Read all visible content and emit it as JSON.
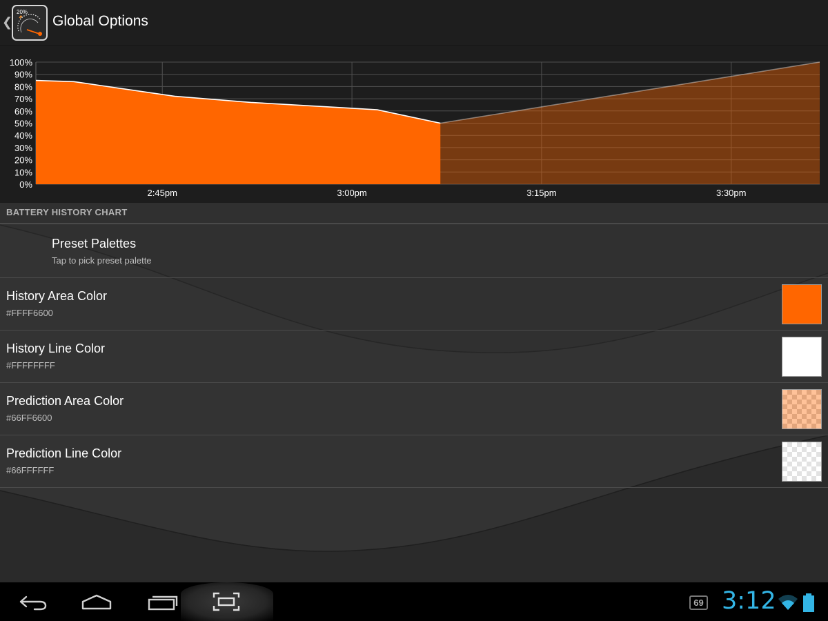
{
  "header": {
    "title": "Global Options",
    "app_icon": {
      "label": "20%",
      "icon": "battery-gauge-icon"
    },
    "back_icon": "chevron-left-icon"
  },
  "chart_data": {
    "type": "area",
    "title": "",
    "xlabel": "",
    "ylabel": "",
    "ylim": [
      0,
      100
    ],
    "yticks": [
      "0%",
      "10%",
      "20%",
      "30%",
      "40%",
      "50%",
      "60%",
      "70%",
      "80%",
      "90%",
      "100%"
    ],
    "xlim": [
      "2:35pm",
      "3:37pm"
    ],
    "xticks": [
      "2:45pm",
      "3:00pm",
      "3:15pm",
      "3:30pm"
    ],
    "grid": true,
    "series": [
      {
        "kind": "history",
        "area_color": "#FF6600",
        "line_color": "#FFFFFF",
        "x": [
          "2:35pm",
          "2:38pm",
          "2:40pm",
          "2:46pm",
          "2:52pm",
          "3:02pm",
          "3:07pm"
        ],
        "values": [
          85,
          84,
          81,
          72,
          67,
          61,
          50
        ]
      },
      {
        "kind": "prediction",
        "area_color": "#66FF6600",
        "line_color": "#66FFFFFF",
        "x": [
          "3:07pm",
          "3:37pm"
        ],
        "values": [
          50,
          100
        ]
      }
    ]
  },
  "section": {
    "header": "BATTERY HISTORY CHART"
  },
  "preferences": [
    {
      "title": "Preset Palettes",
      "summary": "Tap to pick preset palette",
      "swatch": null
    },
    {
      "title": "History Area Color",
      "summary": "#FFFF6600",
      "swatch": "#FF6600",
      "swatch_alpha": 1
    },
    {
      "title": "History Line Color",
      "summary": "#FFFFFFFF",
      "swatch": "#FFFFFF",
      "swatch_alpha": 1
    },
    {
      "title": "Prediction Area Color",
      "summary": "#66FF6600",
      "swatch": "#FF6600",
      "swatch_alpha": 0.4
    },
    {
      "title": "Prediction Line Color",
      "summary": "#66FFFFFF",
      "swatch": "#FFFFFF",
      "swatch_alpha": 0.4
    }
  ],
  "navbar": {
    "back_icon": "back-arrow-icon",
    "home_icon": "home-icon",
    "recents_icon": "recent-apps-icon",
    "screenshot_icon": "screenshot-icon"
  },
  "statusbar": {
    "notification_count": "69",
    "time": "3:12",
    "wifi_icon": "wifi-icon",
    "battery_icon": "battery-icon",
    "accent": "#33B5E5"
  }
}
